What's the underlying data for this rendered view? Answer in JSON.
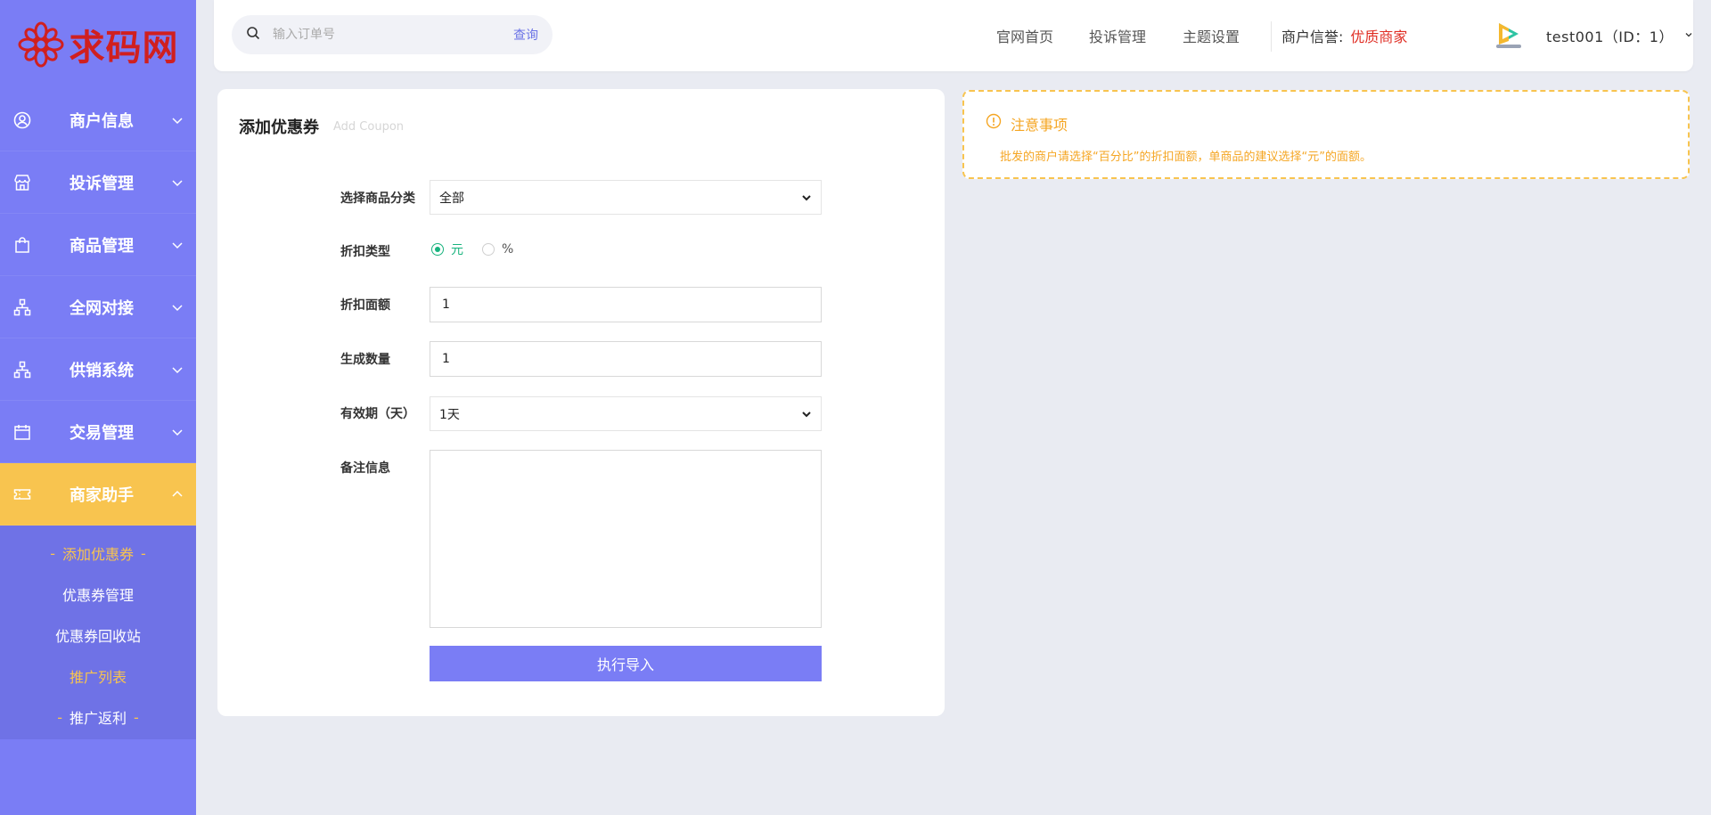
{
  "logo": {
    "text": "求码网"
  },
  "sidebar": {
    "items": [
      {
        "label": "商户信息",
        "icon": "user-circle-icon"
      },
      {
        "label": "投诉管理",
        "icon": "store-icon"
      },
      {
        "label": "商品管理",
        "icon": "shopping-bag-icon"
      },
      {
        "label": "全网对接",
        "icon": "sitemap-icon"
      },
      {
        "label": "供销系统",
        "icon": "sitemap-icon"
      },
      {
        "label": "交易管理",
        "icon": "calendar-icon"
      },
      {
        "label": "商家助手",
        "icon": "ticket-icon",
        "active": true
      }
    ],
    "sub_items": [
      {
        "label": "添加优惠券",
        "state": "current"
      },
      {
        "label": "优惠券管理"
      },
      {
        "label": "优惠券回收站"
      },
      {
        "label": "推广列表"
      },
      {
        "label": "推广返利"
      }
    ]
  },
  "header": {
    "search_placeholder": "输入订单号",
    "search_button": "查询",
    "nav": [
      "官网首页",
      "投诉管理",
      "主题设置"
    ],
    "credit_label": "商户信誉:",
    "credit_value": "优质商家",
    "user": "test001（ID：1）"
  },
  "form": {
    "title": "添加优惠券",
    "subtitle": "Add Coupon",
    "category_label": "选择商品分类",
    "category_value": "全部",
    "discount_type_label": "折扣类型",
    "discount_type_options": [
      "元",
      "%"
    ],
    "discount_type_selected": "元",
    "amount_label": "折扣面额",
    "amount_value": "1",
    "quantity_label": "生成数量",
    "quantity_value": "1",
    "validity_label": "有效期（天）",
    "validity_value": "1天",
    "remark_label": "备注信息",
    "remark_value": "",
    "submit_label": "执行导入"
  },
  "notice": {
    "title": "注意事项",
    "text": "批发的商户请选择“百分比”的折扣面额，单商品的建议选择“元”的面额。"
  },
  "colors": {
    "sidebar": "#7a7df5",
    "accent": "#f8c44f",
    "danger": "#e02e24",
    "radio": "#18b37e"
  }
}
